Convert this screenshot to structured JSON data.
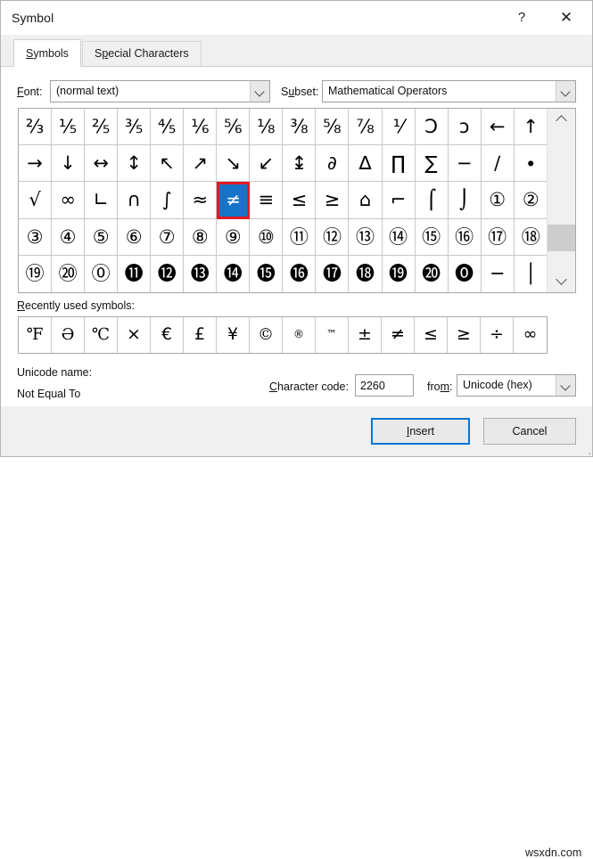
{
  "window": {
    "title": "Symbol",
    "help_icon": "?",
    "close_icon": "✕"
  },
  "tabs": [
    {
      "label": "Symbols",
      "accel": "S",
      "active": true
    },
    {
      "label": "Special Characters",
      "accel": "p",
      "active": false
    }
  ],
  "font_row": {
    "font_label": "Font:",
    "font_accel": "F",
    "font_value": "(normal text)",
    "subset_label": "Subset:",
    "subset_accel": "u",
    "subset_value": "Mathematical Operators"
  },
  "grid": {
    "columns": 16,
    "rows": [
      [
        "⅔",
        "⅕",
        "⅖",
        "⅗",
        "⅘",
        "⅙",
        "⅚",
        "⅛",
        "⅜",
        "⅝",
        "⅞",
        "⅟",
        "Ↄ",
        "ɔ",
        "←",
        "↑"
      ],
      [
        "→",
        "↓",
        "↔",
        "↕",
        "↖",
        "↗",
        "↘",
        "↙",
        "↨",
        "∂",
        "∆",
        "∏",
        "∑",
        "−",
        "∕",
        "∙"
      ],
      [
        "√",
        "∞",
        "∟",
        "∩",
        "∫",
        "≈",
        "≠",
        "≡",
        "≤",
        "≥",
        "⌂",
        "⌐",
        "⌠",
        "⌡",
        "①",
        "②"
      ],
      [
        "③",
        "④",
        "⑤",
        "⑥",
        "⑦",
        "⑧",
        "⑨",
        "⑩",
        "⑪",
        "⑫",
        "⑬",
        "⑭",
        "⑮",
        "⑯",
        "⑰",
        "⑱"
      ],
      [
        "⑲",
        "⑳",
        "⓪",
        "⓫",
        "⓬",
        "⓭",
        "⓮",
        "⓯",
        "⓰",
        "⓱",
        "⓲",
        "⓳",
        "⓴",
        "⓿",
        "─",
        "│"
      ]
    ],
    "selected": {
      "row": 2,
      "col": 6,
      "glyph": "≠"
    },
    "selection_border_color": "#e01b24",
    "selection_fill_color": "#1574c8"
  },
  "recent": {
    "label": "Recently used symbols:",
    "accel": "R",
    "symbols": [
      "℉",
      "Ə",
      "℃",
      "×",
      "€",
      "£",
      "¥",
      "©",
      "®",
      "™",
      "±",
      "≠",
      "≤",
      "≥",
      "÷",
      "∞"
    ]
  },
  "info": {
    "unicode_name_label": "Unicode name:",
    "unicode_name_value": "Not Equal To",
    "charcode_label": "Character code:",
    "charcode_accel": "C",
    "charcode_value": "2260",
    "from_label": "from:",
    "from_accel": "m",
    "from_value": "Unicode (hex)"
  },
  "footer": {
    "insert_label": "Insert",
    "insert_accel": "I",
    "cancel_label": "Cancel"
  },
  "watermark": "wsxdn.com"
}
